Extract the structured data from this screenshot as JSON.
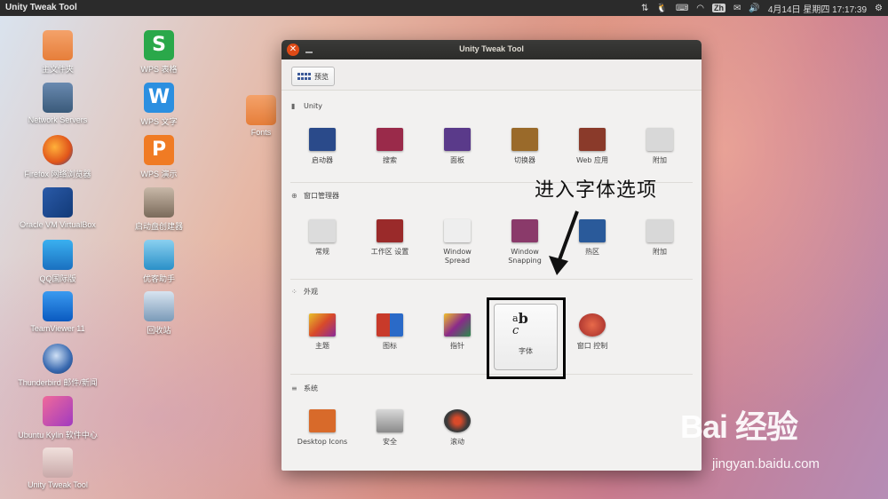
{
  "topbar": {
    "app_title": "Unity Tweak Tool",
    "tray": {
      "input_method": "Zh",
      "datetime": "4月14日 星期四 17:17:39"
    }
  },
  "desktop": {
    "icons": [
      {
        "label": "主文件夹",
        "icon": "folder-icon",
        "color": "#ef8d4c"
      },
      {
        "label": "Network Servers",
        "icon": "network-icon",
        "color": "#4a6a8a"
      },
      {
        "label": "Firefox 网络浏览器",
        "icon": "firefox-icon",
        "color": "#e66a1f"
      },
      {
        "label": "Oracle VM VirtualBox",
        "icon": "virtualbox-icon",
        "color": "#1f4a8c"
      },
      {
        "label": "QQ国际版",
        "icon": "qq-icon",
        "color": "#1a8fd8"
      },
      {
        "label": "TeamViewer 11",
        "icon": "teamviewer-icon",
        "color": "#0e6fd1"
      },
      {
        "label": "Thunderbird 邮件/新闻",
        "icon": "thunderbird-icon",
        "color": "#2f5f9e"
      },
      {
        "label": "Ubuntu Kylin 软件中心",
        "icon": "software-center-icon",
        "color": "#e25a8c"
      },
      {
        "label": "Unity Tweak Tool",
        "icon": "unity-tweak-icon",
        "color": "#c8a0a0"
      },
      {
        "label": "WPS 表格",
        "icon": "wps-spreadsheet-icon",
        "color": "#2aa84a"
      },
      {
        "label": "WPS 文字",
        "icon": "wps-writer-icon",
        "color": "#2b8fe0"
      },
      {
        "label": "WPS 演示",
        "icon": "wps-presentation-icon",
        "color": "#f07b24"
      },
      {
        "label": "启动盘创建器",
        "icon": "startup-disk-icon",
        "color": "#7a6a5a"
      },
      {
        "label": "优客助手",
        "icon": "youker-assistant-icon",
        "color": "#3aa0d8"
      },
      {
        "label": "回收站",
        "icon": "trash-icon",
        "color": "#6a8aaa"
      },
      {
        "label": "Fonts",
        "icon": "folder-icon",
        "color": "#ef8d4c"
      }
    ]
  },
  "window": {
    "title": "Unity Tweak Tool",
    "toolbar": {
      "overview_label": "预览"
    },
    "sections": [
      {
        "title": "Unity",
        "items": [
          {
            "label": "启动器",
            "color": "#2a4a8a"
          },
          {
            "label": "搜索",
            "color": "#9a2a4a"
          },
          {
            "label": "面板",
            "color": "#5a3a8a"
          },
          {
            "label": "切换器",
            "color": "#9a6a2a"
          },
          {
            "label": "Web 应用",
            "color": "#8a3a2a"
          },
          {
            "label": "附加",
            "color": "#c8c8c8"
          }
        ]
      },
      {
        "title": "窗口管理器",
        "items": [
          {
            "label": "常规",
            "color": "#dcdcdc"
          },
          {
            "label": "工作区 设置",
            "color": "#9a2a2a"
          },
          {
            "label": "Window Spread",
            "color": "#eeeeee"
          },
          {
            "label": "Window Snapping",
            "color": "#8a3a6a"
          },
          {
            "label": "热区",
            "color": "#2a5a9a"
          },
          {
            "label": "附加",
            "color": "#c8c8c8"
          }
        ]
      },
      {
        "title": "外观",
        "items": [
          {
            "label": "主题",
            "color": "#d84a2a"
          },
          {
            "label": "图标",
            "color": "#c83a2a"
          },
          {
            "label": "指针",
            "color": "#8a2a8a"
          },
          {
            "label": "字体",
            "color": "#f5f5f5"
          },
          {
            "label": "窗口 控制",
            "color": "#c84a3a"
          }
        ]
      },
      {
        "title": "系统",
        "items": [
          {
            "label": "Desktop Icons",
            "color": "#d86a2a"
          },
          {
            "label": "安全",
            "color": "#9a9a9a"
          },
          {
            "label": "滚动",
            "color": "#3a3a3a"
          }
        ]
      }
    ],
    "font_tile_glyph": "ᵃb\nc"
  },
  "annotation": {
    "text": "进入字体选项"
  },
  "watermark": {
    "brand": "Bai 经验",
    "url": "jingyan.baidu.com"
  }
}
